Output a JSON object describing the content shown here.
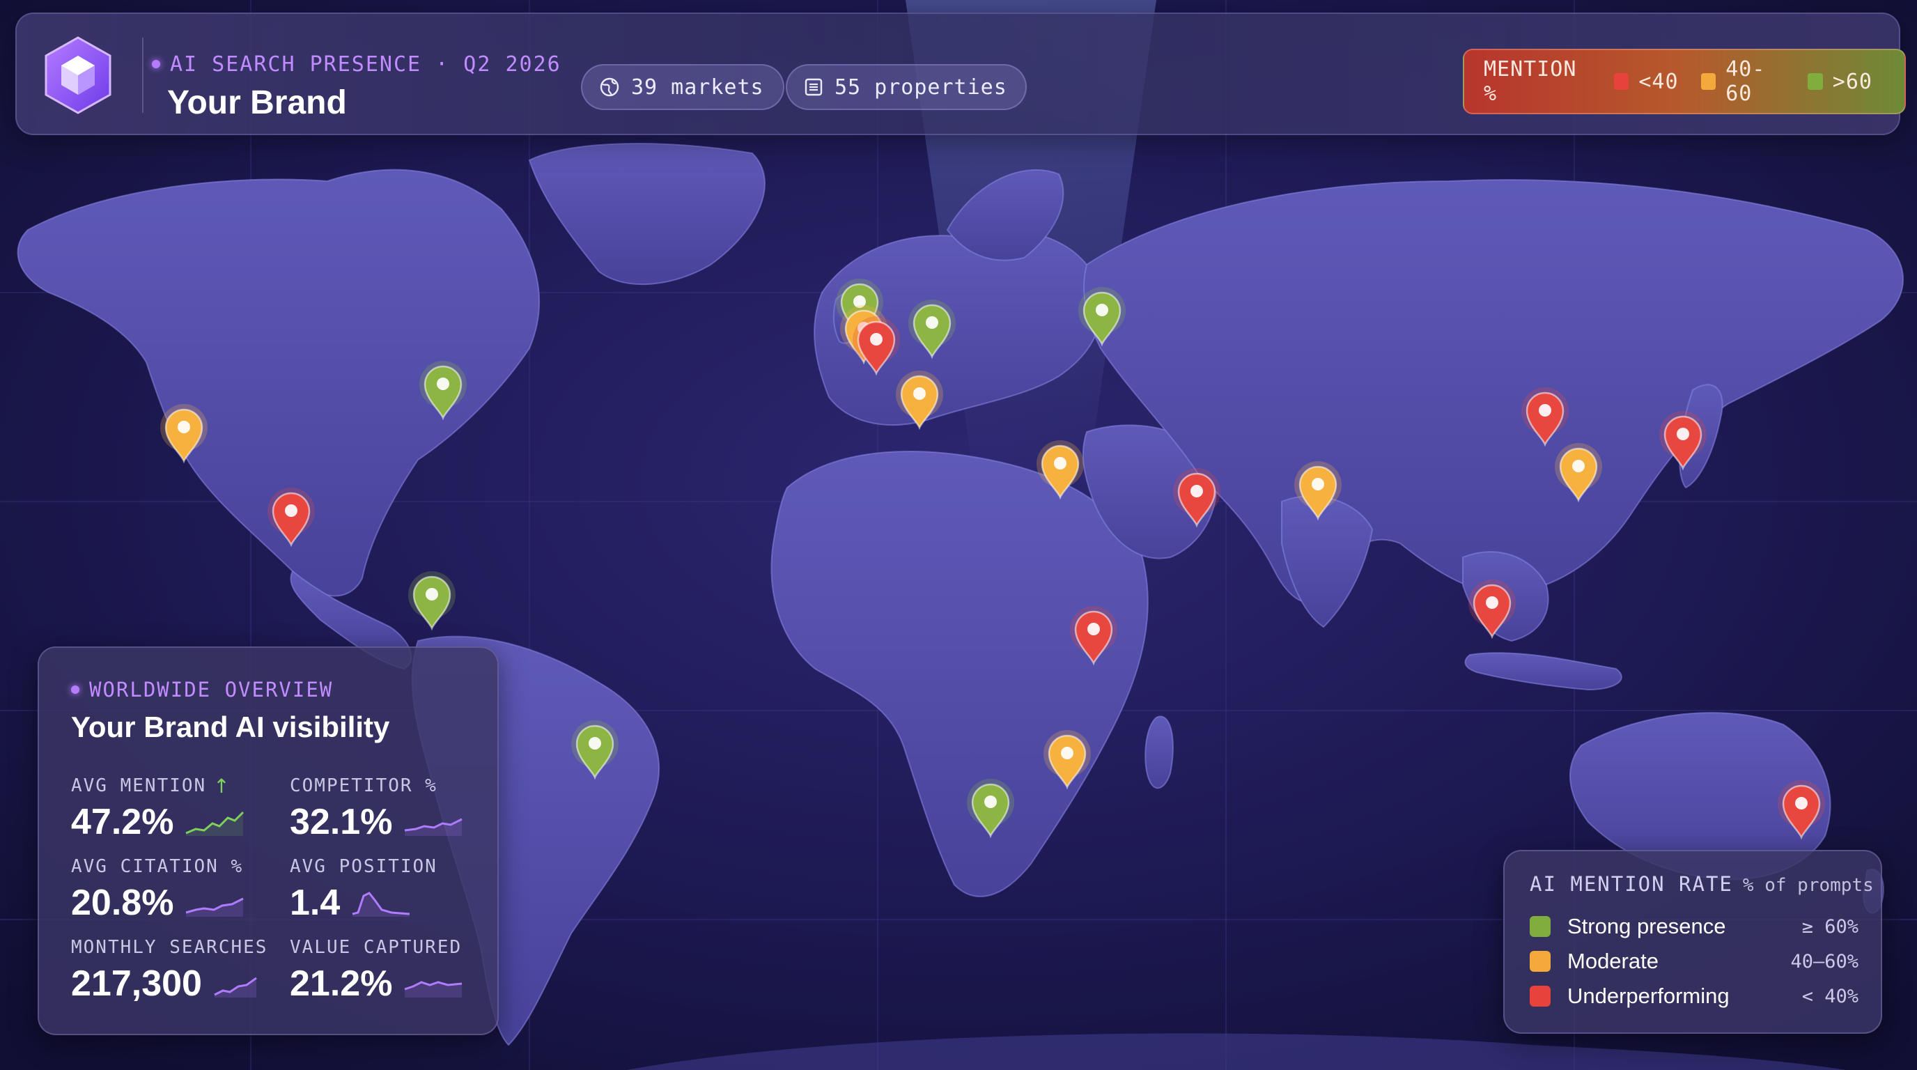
{
  "header": {
    "eyebrow": "AI SEARCH PRESENCE · Q2 2026",
    "brand": "Your Brand",
    "markets_label": "39 markets",
    "properties_label": "55 properties",
    "legend": {
      "label": "MENTION %",
      "items": [
        {
          "text": "<40",
          "color": "#e8423c"
        },
        {
          "text": "40-60",
          "color": "#f4a93a"
        },
        {
          "text": ">60",
          "color": "#7fae3f"
        }
      ]
    }
  },
  "overview": {
    "eyebrow": "WORLDWIDE OVERVIEW",
    "title": "Your Brand AI visibility",
    "up_arrow": "↑",
    "metrics": [
      {
        "label": "AVG MENTION",
        "value": "47.2%"
      },
      {
        "label": "COMPETITOR %",
        "value": "32.1%"
      },
      {
        "label": "AVG CITATION %",
        "value": "20.8%"
      },
      {
        "label": "AVG POSITION",
        "value": "1.4"
      },
      {
        "label": "MONTHLY SEARCHES",
        "value": "217,300"
      },
      {
        "label": "VALUE CAPTURED",
        "value": "21.2%"
      }
    ]
  },
  "rate_legend": {
    "title": "AI MENTION RATE",
    "subtitle": "% of prompts",
    "rows": [
      {
        "name": "Strong presence",
        "range": "≥ 60%",
        "color": "#7fae3f"
      },
      {
        "name": "Moderate",
        "range": "40–60%",
        "color": "#f4a93a"
      },
      {
        "name": "Underperforming",
        "range": "< 40%",
        "color": "#e8423c"
      }
    ]
  },
  "pin_colors": {
    "strong": "#8cb544",
    "moderate": "#f6b13e",
    "under": "#e8473f"
  },
  "icons": {
    "logo": "hexagon-cube-icon",
    "markets": "globe-icon",
    "properties": "list-icon"
  }
}
